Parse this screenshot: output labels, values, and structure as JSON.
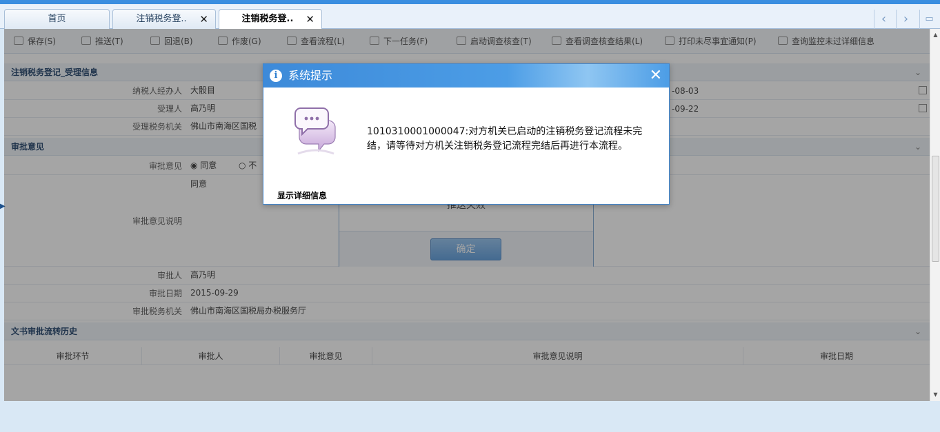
{
  "tabs": [
    {
      "label": "首页",
      "closable": false,
      "active": false
    },
    {
      "label": "注销税务登..",
      "closable": true,
      "active": false
    },
    {
      "label": "注销税务登..",
      "closable": true,
      "active": true
    }
  ],
  "toolbar": {
    "items": [
      "保存(S)",
      "推送(T)",
      "回退(B)",
      "作废(G)",
      "查看流程(L)",
      "下一任务(F)",
      "启动调查核查(T)",
      "查看调查核查结果(L)",
      "打印未尽事宜通知(P)",
      "查询监控未过详细信息"
    ]
  },
  "section1": {
    "title": "注销税务登记_受理信息",
    "rows": [
      {
        "label": "纳税人经办人",
        "value": "大骰目",
        "right_value": "-08-03"
      },
      {
        "label": "受理人",
        "value": "高乃明",
        "right_value": "-09-22"
      },
      {
        "label": "受理税务机关",
        "value": "佛山市南海区国税"
      }
    ]
  },
  "section2": {
    "title": "审批意见",
    "opinion_label": "审批意见",
    "radio_agree": "同意",
    "radio_disagree": "不",
    "desc_label": "审批意见说明",
    "desc_value": "同意",
    "approver_label": "审批人",
    "approver_value": "高乃明",
    "date_label": "审批日期",
    "date_value": "2015-09-29",
    "org_label": "审批税务机关",
    "org_value": "佛山市南海区国税局办税服务厅"
  },
  "section3": {
    "title": "文书审批流转历史",
    "columns": [
      "审批环节",
      "审批人",
      "审批意见",
      "审批意见说明",
      "审批日期"
    ]
  },
  "inner_dialog": {
    "message": "推送失败",
    "ok_label": "确定"
  },
  "dialog": {
    "title": "系统提示",
    "message": "1010310001000047:对方机关已启动的注销税务登记流程未完结，请等待对方机关注销税务登记流程完结后再进行本流程。",
    "detail_link": "显示详细信息",
    "close": "✕"
  }
}
